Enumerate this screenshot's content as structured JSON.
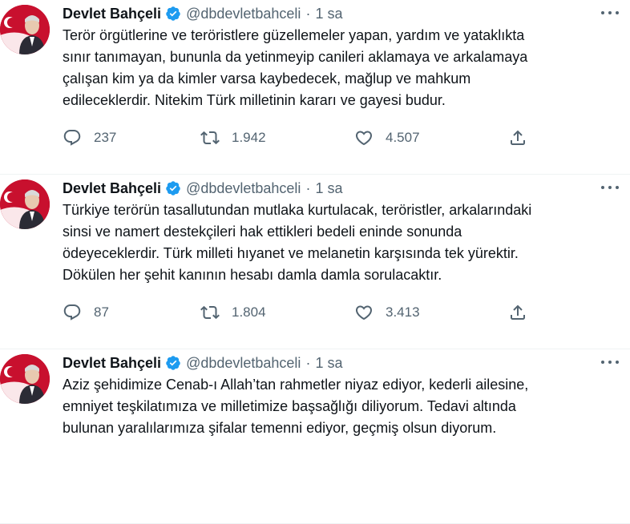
{
  "tweets": [
    {
      "name": "Devlet Bahçeli",
      "handle": "@dbdevletbahceli",
      "dot": "·",
      "time": "1 sa",
      "text": "Terör örgütlerine ve teröristlere güzellemeler yapan, yardım ve yataklıkta\nsınır tanımayan, bununla da yetinmeyip canileri aklamaya ve arkalamaya\nçalışan kim ya da kimler varsa kaybedecek, mağlup ve mahkum\nedileceklerdir. Nitekim Türk milletinin kararı ve gayesi budur.",
      "replies": "237",
      "retweets": "1.942",
      "likes": "4.507"
    },
    {
      "name": "Devlet Bahçeli",
      "handle": "@dbdevletbahceli",
      "dot": "·",
      "time": "1 sa",
      "text": "Türkiye terörün tasallutundan mutlaka kurtulacak, teröristler, arkalarındaki\nsinsi ve namert destekçileri hak ettikleri bedeli eninde sonunda\nödeyeceklerdir. Türk milleti hıyanet ve melanetin karşısında tek yürektir.\nDökülen her şehit kanının hesabı damla damla sorulacaktır.",
      "replies": "87",
      "retweets": "1.804",
      "likes": "3.413"
    },
    {
      "name": "Devlet Bahçeli",
      "handle": "@dbdevletbahceli",
      "dot": "·",
      "time": "1 sa",
      "text": "Aziz şehidimize Cenab-ı Allah’tan rahmetler niyaz ediyor, kederli ailesine,\nemniyet teşkilatımıza ve milletimize başsağlığı diliyorum. Tedavi altında\nbulunan yaralılarımıza şifalar temenni ediyor, geçmiş olsun diyorum."
    }
  ],
  "colors": {
    "accent": "#1d9bf0",
    "text_primary": "#0f1419",
    "text_secondary": "#536471",
    "avatar_bg": "#c8102e"
  },
  "icons": [
    "verified-badge-icon",
    "more-icon",
    "reply-icon",
    "retweet-icon",
    "like-icon",
    "share-icon"
  ]
}
